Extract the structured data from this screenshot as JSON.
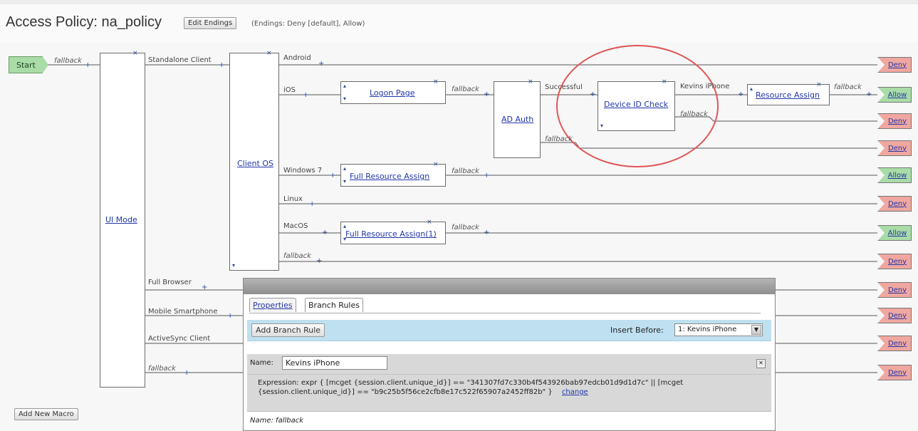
{
  "header": {
    "title": "Access Policy: na_policy",
    "edit_endings": "Edit Endings",
    "endings_note": "(Endings: Deny [default], Allow)"
  },
  "canvas": {
    "start": "Start",
    "fallback": "fallback",
    "ui_mode": "UI Mode",
    "client_os": "Client OS",
    "logon_page": "Logon Page",
    "ad_auth": "AD Auth",
    "device_id_check": "Device ID Check",
    "resource_assign": "Resource Assign",
    "full_resource_assign": "Full Resource Assign",
    "full_resource_assign_1": "Full Resource Assign(1)",
    "branches": {
      "standalone": "Standalone Client",
      "full_browser": "Full Browser",
      "mobile": "Mobile Smartphone",
      "activesync": "ActiveSync Client",
      "android": "Android",
      "ios": "iOS",
      "windows7": "Windows 7",
      "linux": "Linux",
      "macos": "MacOS",
      "successful": "Successful",
      "kevins": "Kevins iPhone"
    },
    "deny": "Deny",
    "allow": "Allow"
  },
  "dialog": {
    "tab_properties": "Properties",
    "tab_branch_rules": "Branch Rules",
    "add_branch_rule": "Add Branch Rule",
    "insert_before_label": "Insert Before:",
    "insert_before_value": "1: Kevins iPhone",
    "name_label": "Name:",
    "name_value": "Kevins iPhone",
    "expression_line1": "Expression: expr { [mcget {session.client.unique_id}] == \"341307fd7c330b4f543926bab97edcb01d9d1d7c\" || [mcget",
    "expression_line2": "{session.client.unique_id}] == \"b9c25b5f56ce2cfb8e17c522f65907a2452ff82b\" }",
    "change_link": "change",
    "next_name": "Name: fallback"
  },
  "footer": {
    "add_new_macro": "Add New Macro"
  },
  "colors": {
    "deny": "#f0a7a0",
    "allow": "#a9dca6",
    "highlight_circle": "#e05555",
    "link": "#2236a8"
  }
}
